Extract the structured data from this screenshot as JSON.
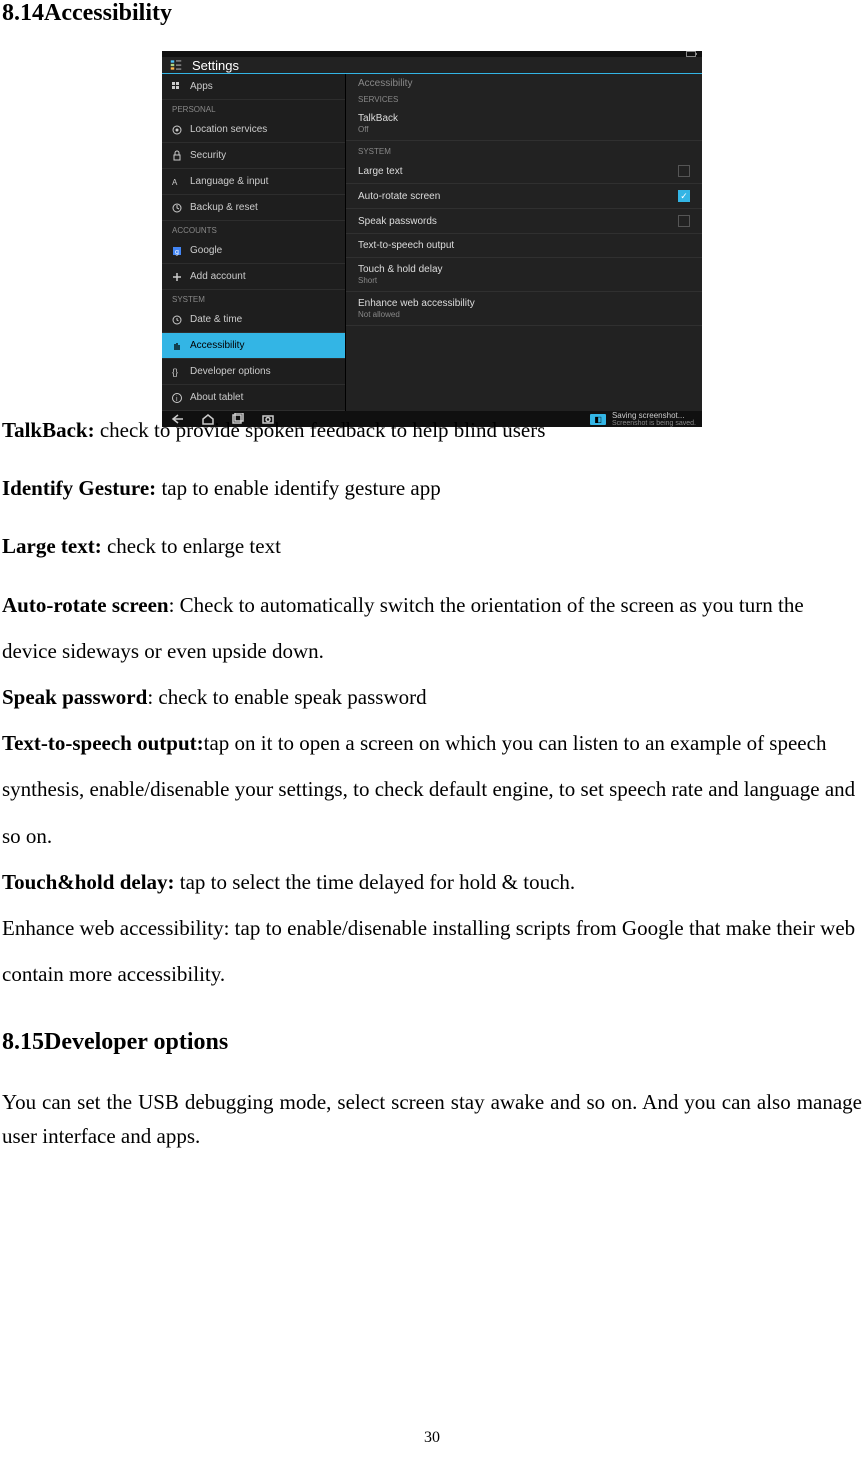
{
  "headings": {
    "h1": "8.14Accessibility",
    "h2": "8.15Developer options"
  },
  "screenshot": {
    "title": "Settings",
    "status": {
      "battery": "Battery"
    },
    "left": {
      "items": [
        {
          "label": "Apps",
          "icon": "apps"
        }
      ],
      "cat_personal": "PERSONAL",
      "personal": [
        {
          "label": "Location services",
          "icon": "location"
        },
        {
          "label": "Security",
          "icon": "security"
        },
        {
          "label": "Language & input",
          "icon": "lang"
        },
        {
          "label": "Backup & reset",
          "icon": "backup"
        }
      ],
      "cat_accounts": "ACCOUNTS",
      "accounts": [
        {
          "label": "Google",
          "icon": "google"
        },
        {
          "label": "Add account",
          "icon": "add"
        }
      ],
      "cat_system": "SYSTEM",
      "system": [
        {
          "label": "Date & time",
          "icon": "clock"
        },
        {
          "label": "Accessibility",
          "icon": "hand",
          "selected": true
        },
        {
          "label": "Developer options",
          "icon": "dev"
        },
        {
          "label": "About tablet",
          "icon": "about"
        }
      ]
    },
    "right": {
      "header": "Accessibility",
      "cat_services": "SERVICES",
      "services": [
        {
          "label": "TalkBack",
          "sub": "Off"
        }
      ],
      "cat_system": "SYSTEM",
      "system": [
        {
          "label": "Large text",
          "check": false
        },
        {
          "label": "Auto-rotate screen",
          "check": true
        },
        {
          "label": "Speak passwords",
          "check": false
        },
        {
          "label": "Text-to-speech output"
        },
        {
          "label": "Touch & hold delay",
          "sub": "Short"
        },
        {
          "label": "Enhance web accessibility",
          "sub": "Not allowed"
        }
      ]
    },
    "navbar": {
      "toast1": "Saving screenshot...",
      "toast2": "Screenshot is being saved."
    }
  },
  "defs": {
    "talkback_label": "TalkBack: ",
    "talkback_text": "check to provide spoken feedback to help blind users",
    "identify_label": "Identify Gesture: ",
    "identify_text": "tap to enable identify gesture app",
    "large_label": "Large text: ",
    "large_text": "check to enlarge text",
    "autorotate_label": "Auto-rotate screen",
    "autorotate_text": ": Check to automatically switch the orientation of the screen as you turn the device sideways or even upside down.",
    "speak_label": "Speak password",
    "speak_text": ": check to enable speak password",
    "tts_label": "Text-to-speech output:",
    "tts_text": "tap on it to open a screen on which you can listen to an example of speech synthesis, enable/disenable your settings, to check default engine, to set speech rate and language and so on.",
    "touch_label": "Touch&hold delay: ",
    "touch_text": "tap to select the time delayed for hold & touch.",
    "enhance_text": "Enhance web accessibility: tap to enable/disenable installing scripts from Google that make their web contain more accessibility."
  },
  "dev_options_para": "You can set the USB debugging mode, select screen stay awake and so on. And you can also manage user interface and apps.",
  "page_number": "30"
}
